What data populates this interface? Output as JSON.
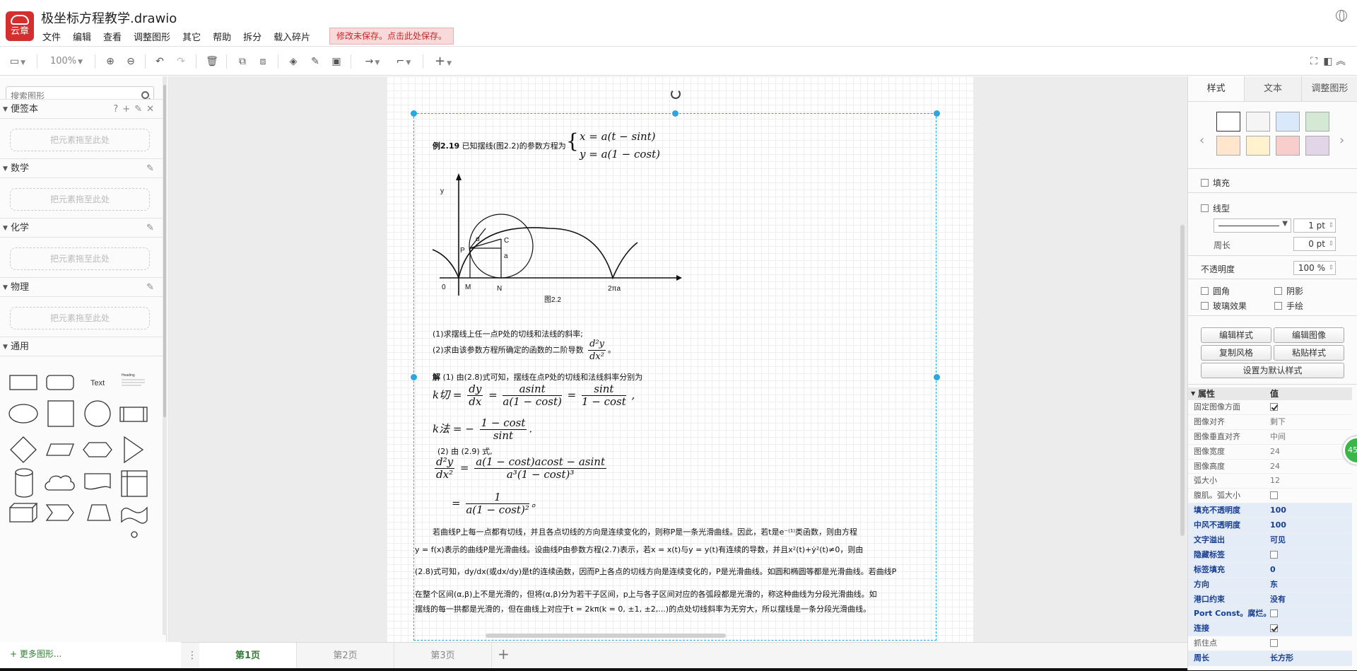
{
  "app": {
    "logo_text": "云章",
    "doc_title": "极坐标方程教学.drawio",
    "unsaved_notice": "修改未保存。点击此处保存。"
  },
  "menu": [
    "文件",
    "编辑",
    "查看",
    "调整图形",
    "其它",
    "帮助",
    "拆分",
    "载入碎片"
  ],
  "toolbar": {
    "zoom": "100%"
  },
  "left": {
    "search_placeholder": "搜索图形",
    "sections": [
      {
        "label": "便签本",
        "tools": [
          "?",
          "+",
          "✎",
          "✕"
        ],
        "drop": "把元素拖至此处"
      },
      {
        "label": "数学",
        "tools": [
          "✎"
        ],
        "drop": "把元素拖至此处"
      },
      {
        "label": "化学",
        "tools": [
          "✎"
        ],
        "drop": "把元素拖至此处"
      },
      {
        "label": "物理",
        "tools": [
          "✎"
        ],
        "drop": "把元素拖至此处"
      },
      {
        "label": "通用"
      }
    ],
    "shape_text": "Text",
    "shape_heading": "Heading",
    "more_shapes": "更多图形..."
  },
  "doc": {
    "example_title": "例2.19",
    "example_text": "已知摆线(图2.2)的参数方程为",
    "eq1": "x = a(t − sint)",
    "eq2": "y = a(1 − cost)",
    "fig_labels": {
      "y": "y",
      "alpha": "α",
      "p": "P",
      "c": "C",
      "a": "a",
      "o": "0",
      "m": "M",
      "n": "N",
      "two_pi_a": "2πa"
    },
    "fig_caption": "图2.2",
    "q1": "(1)求摆线上任一点P处的切线和法线的斜率;",
    "q2": "(2)求由该参数方程所确定的函数的二阶导数",
    "q2_num": "d²y",
    "q2_den": "dx²",
    "sol_label": "解",
    "sol_text": "(1) 由(2.8)式可知，摆线在点P处的切线和法线斜率分别为",
    "k_qie": "k切 =",
    "dy": "dy",
    "dx": "dx",
    "asint": "asint",
    "a_1_cost": "a(1 − cost)",
    "sint": "sint",
    "one_cost": "1 − cost",
    "k_fa": "k法 = −",
    "part2": "(2) 由 (2.9) 式,",
    "d2y": "d²y",
    "dx2": "dx²",
    "big_num": "a(1 − cost)acost − asint",
    "big_den": "a³(1 − cost)³",
    "one": "1",
    "last_den": "a(1 − cost)²",
    "para1": "若曲线P上每一点都有切线，并且各点切线的方向是连续变化的，则称P是一条光滑曲线。因此，若t是e⁻⁽¹⁾类函数，则由方程",
    "para2": "y = f(x)表示的曲线P是光滑曲线。设曲线P由参数方程(2.7)表示，若x = x(t)与y = y(t)有连续的导数，并且x²(t)+ẏ²(t)≠0，则由",
    "para3": "(2.8)式可知，dy/dx(或dx/dy)是t的连续函数，因而P上各点的切线方向是连续变化的，P是光滑曲线。如圆和椭圆等都是光滑曲线。若曲线P",
    "para4": "在整个区间(α,β)上不是光滑的，但将(α,β)分为若干子区间，p上与各子区间对应的各弧段都是光滑的，称这种曲线为分段光滑曲线。如",
    "para5": "摆线的每一拱都是光滑的，但在曲线上对应于t = 2kπ(k = 0, ±1, ±2,...)的点处切线斜率为无穷大，所以摆线是一条分段光滑曲线。"
  },
  "pages": [
    "第1页",
    "第2页",
    "第3页"
  ],
  "right": {
    "tabs": [
      "样式",
      "文本",
      "调整图形"
    ],
    "swatches": [
      "#ffffff",
      "#f5f5f5",
      "#dae8fc",
      "#d5e8d4",
      "#ffe6cc",
      "#fff2cc",
      "#f8cecc",
      "#e1d5e7"
    ],
    "fill": "填充",
    "line": "线型",
    "line_width": "1 pt",
    "perimeter": "周长",
    "perimeter_val": "0 pt",
    "opacity": "不透明度",
    "opacity_val": "100 %",
    "rounded": "圆角",
    "shadow": "阴影",
    "glass": "玻璃效果",
    "sketch": "手绘",
    "btn_edit_style": "编辑样式",
    "btn_edit_image": "编辑图像",
    "btn_copy_style": "复制风格",
    "btn_paste_style": "粘贴样式",
    "btn_set_default": "设置为默认样式",
    "prop_header": "属性",
    "val_header": "值",
    "props": [
      {
        "k": "固定图像方面",
        "v": "",
        "cb": true,
        "on": true
      },
      {
        "k": "图像对齐",
        "v": "剩下"
      },
      {
        "k": "图像垂直对齐",
        "v": "中间"
      },
      {
        "k": "图像宽度",
        "v": "24"
      },
      {
        "k": "图像高度",
        "v": "24"
      },
      {
        "k": "弧大小",
        "v": "12"
      },
      {
        "k": "腹肌。弧大小",
        "v": "",
        "cb": true,
        "on": false
      },
      {
        "k": "填充不透明度",
        "v": "100",
        "hl": true
      },
      {
        "k": "中风不透明度",
        "v": "100",
        "hl": true
      },
      {
        "k": "文字溢出",
        "v": "可见",
        "hl": true
      },
      {
        "k": "隐藏标签",
        "v": "",
        "cb": true,
        "on": false,
        "hl": true
      },
      {
        "k": "标签填充",
        "v": "0",
        "hl": true
      },
      {
        "k": "方向",
        "v": "东",
        "hl": true
      },
      {
        "k": "港口约束",
        "v": "没有",
        "hl": true
      },
      {
        "k": "Port Const。腐烂。",
        "v": "",
        "cb": true,
        "on": false,
        "hl": true
      },
      {
        "k": "连接",
        "v": "",
        "cb": true,
        "on": true,
        "hl": true
      },
      {
        "k": "抓住点",
        "v": "",
        "cb": true,
        "on": false
      },
      {
        "k": "周长",
        "v": "长方形",
        "hl": true
      }
    ],
    "green_badge": "45"
  }
}
